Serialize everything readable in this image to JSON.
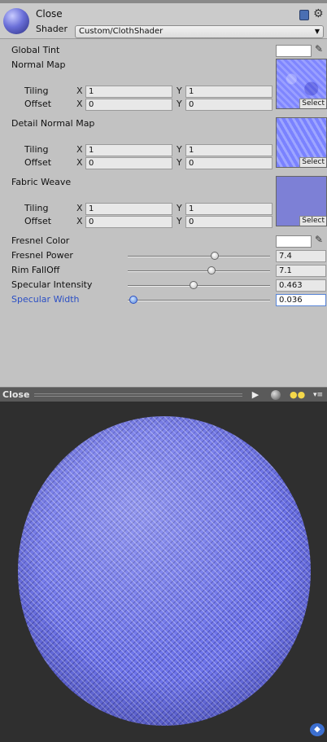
{
  "header": {
    "material_name": "Close",
    "shader_label": "Shader",
    "shader_value": "Custom/ClothShader",
    "icons": [
      "help-book-icon",
      "gear-icon"
    ]
  },
  "properties": {
    "global_tint": {
      "label": "Global Tint",
      "color": "#ffffff"
    },
    "normal_map": {
      "label": "Normal Map",
      "tiling_label": "Tiling",
      "offset_label": "Offset",
      "tiling_x": "1",
      "tiling_y": "1",
      "offset_x": "0",
      "offset_y": "0",
      "select_label": "Select"
    },
    "detail_normal_map": {
      "label": "Detail Normal Map",
      "tiling_label": "Tiling",
      "offset_label": "Offset",
      "tiling_x": "1",
      "tiling_y": "1",
      "offset_x": "0",
      "offset_y": "0",
      "select_label": "Select"
    },
    "fabric_weave": {
      "label": "Fabric Weave",
      "tiling_label": "Tiling",
      "offset_label": "Offset",
      "tiling_x": "1",
      "tiling_y": "1",
      "offset_x": "0",
      "offset_y": "0",
      "select_label": "Select"
    },
    "axis_x": "X",
    "axis_y": "Y",
    "fresnel_color": {
      "label": "Fresnel Color",
      "color": "#ffffff"
    },
    "sliders": [
      {
        "label": "Fresnel Power",
        "value": "7.4",
        "fraction": 0.61
      },
      {
        "label": "Rim FallOff",
        "value": "7.1",
        "fraction": 0.59
      },
      {
        "label": "Specular Intensity",
        "value": "0.463",
        "fraction": 0.46
      },
      {
        "label": "Specular Width",
        "value": "0.036",
        "fraction": 0.04
      }
    ]
  },
  "preview": {
    "title": "Close",
    "play_glyph": "▶",
    "lights_glyph": "●●",
    "menu_glyph": "▾≡"
  },
  "colors": {
    "active_label": "#2b4fc4",
    "panel_bg": "#c2c2c2",
    "preview_bg": "#2f2f2f"
  }
}
